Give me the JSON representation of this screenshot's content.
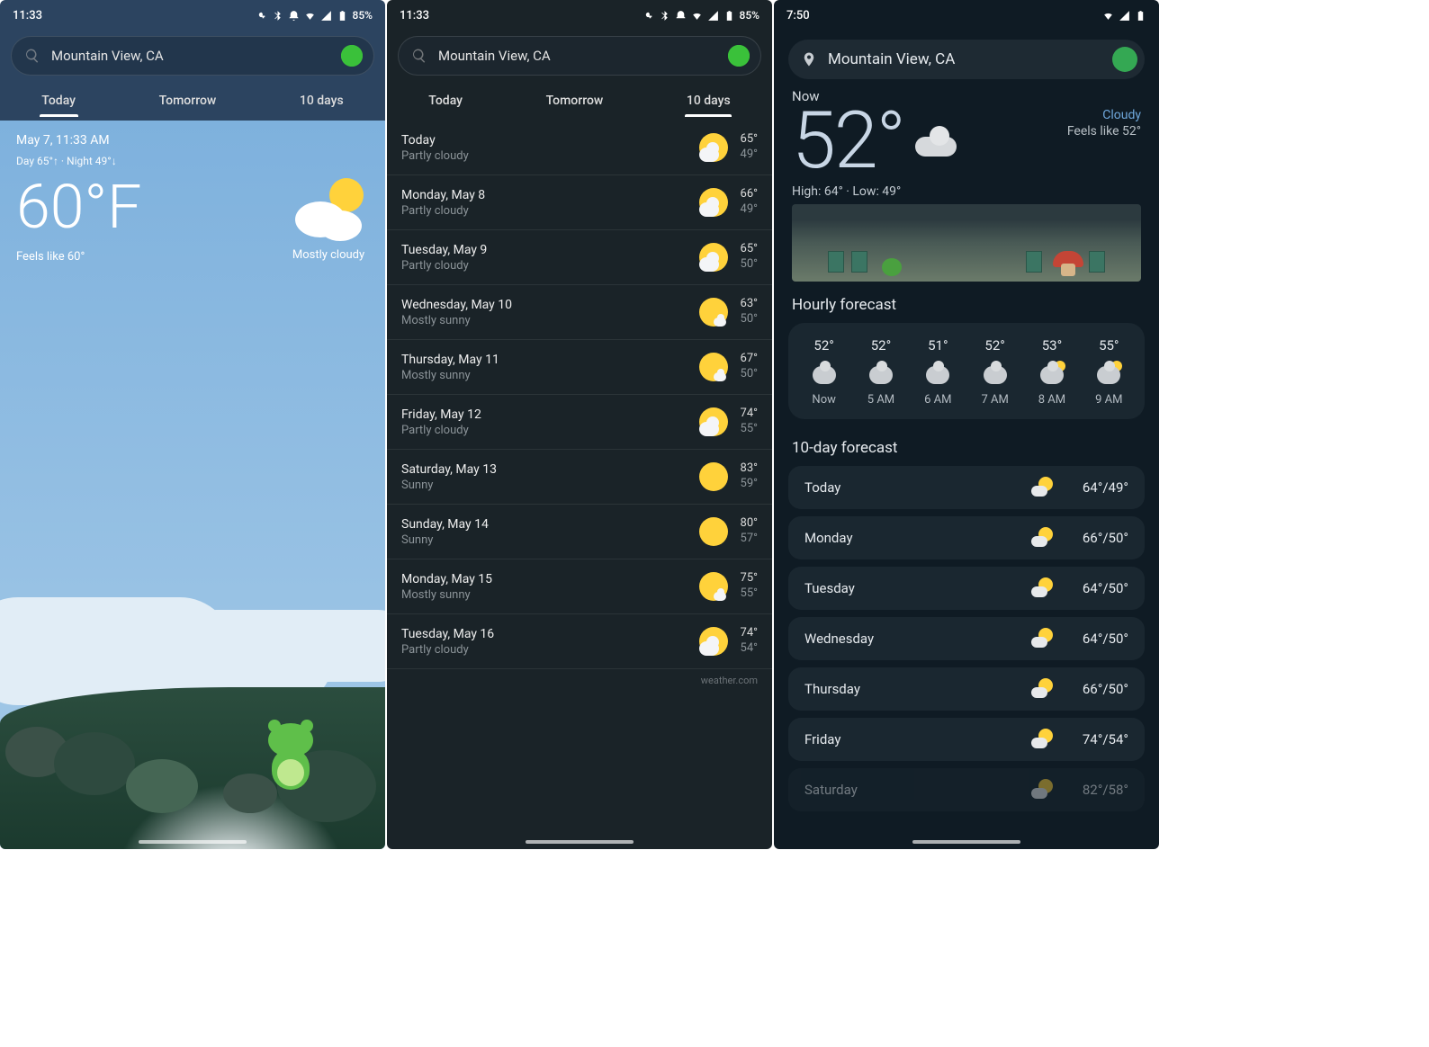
{
  "phone1": {
    "status": {
      "time": "11:33",
      "battery": "85%"
    },
    "location": "Mountain View, CA",
    "tabs": [
      "Today",
      "Tomorrow",
      "10 days"
    ],
    "activeTab": 0,
    "today": {
      "date": "May 7, 11:33 AM",
      "dayNight": "Day 65°↑ · Night 49°↓",
      "temp": "60°F",
      "feels": "Feels like 60°",
      "condition": "Mostly cloudy"
    }
  },
  "phone2": {
    "status": {
      "time": "11:33",
      "battery": "85%"
    },
    "location": "Mountain View, CA",
    "tabs": [
      "Today",
      "Tomorrow",
      "10 days"
    ],
    "activeTab": 2,
    "days": [
      {
        "name": "Today",
        "cond": "Partly cloudy",
        "hi": "65°",
        "lo": "49°",
        "icon": "partly"
      },
      {
        "name": "Monday, May 8",
        "cond": "Partly cloudy",
        "hi": "66°",
        "lo": "49°",
        "icon": "partly"
      },
      {
        "name": "Tuesday, May 9",
        "cond": "Partly cloudy",
        "hi": "65°",
        "lo": "50°",
        "icon": "partly"
      },
      {
        "name": "Wednesday, May 10",
        "cond": "Mostly sunny",
        "hi": "63°",
        "lo": "50°",
        "icon": "mostlysunny"
      },
      {
        "name": "Thursday, May 11",
        "cond": "Mostly sunny",
        "hi": "67°",
        "lo": "50°",
        "icon": "mostlysunny"
      },
      {
        "name": "Friday, May 12",
        "cond": "Partly cloudy",
        "hi": "74°",
        "lo": "55°",
        "icon": "partly"
      },
      {
        "name": "Saturday, May 13",
        "cond": "Sunny",
        "hi": "83°",
        "lo": "59°",
        "icon": "sunny"
      },
      {
        "name": "Sunday, May 14",
        "cond": "Sunny",
        "hi": "80°",
        "lo": "57°",
        "icon": "sunny"
      },
      {
        "name": "Monday, May 15",
        "cond": "Mostly sunny",
        "hi": "75°",
        "lo": "55°",
        "icon": "mostlysunny"
      },
      {
        "name": "Tuesday, May 16",
        "cond": "Partly cloudy",
        "hi": "74°",
        "lo": "54°",
        "icon": "partly"
      }
    ],
    "attribution": "weather.com"
  },
  "phone3": {
    "status": {
      "time": "7:50"
    },
    "location": "Mountain View, CA",
    "now": {
      "label": "Now",
      "temp": "52°",
      "condition": "Cloudy",
      "feels": "Feels like 52°",
      "hilo": "High: 64° · Low: 49°"
    },
    "hourlyTitle": "Hourly forecast",
    "hourly": [
      {
        "t": "52°",
        "lbl": "Now",
        "icon": "cloud"
      },
      {
        "t": "52°",
        "lbl": "5 AM",
        "icon": "cloud"
      },
      {
        "t": "51°",
        "lbl": "6 AM",
        "icon": "cloud"
      },
      {
        "t": "52°",
        "lbl": "7 AM",
        "icon": "cloud"
      },
      {
        "t": "53°",
        "lbl": "8 AM",
        "icon": "sunpeek"
      },
      {
        "t": "55°",
        "lbl": "9 AM",
        "icon": "sunpeek"
      }
    ],
    "tendayTitle": "10-day forecast",
    "tenday": [
      {
        "d": "Today",
        "tm": "64°/49°"
      },
      {
        "d": "Monday",
        "tm": "66°/50°"
      },
      {
        "d": "Tuesday",
        "tm": "64°/50°"
      },
      {
        "d": "Wednesday",
        "tm": "64°/50°"
      },
      {
        "d": "Thursday",
        "tm": "66°/50°"
      },
      {
        "d": "Friday",
        "tm": "74°/54°"
      },
      {
        "d": "Saturday",
        "tm": "82°/58°"
      }
    ]
  }
}
